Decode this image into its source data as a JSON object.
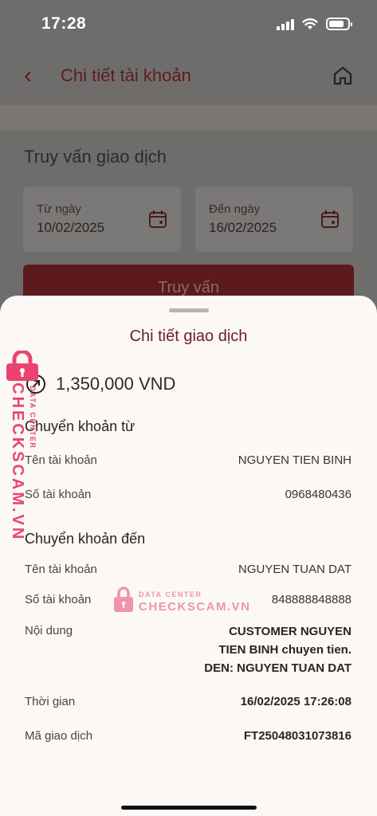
{
  "status_bar": {
    "time": "17:28"
  },
  "header": {
    "title": "Chi tiết tài khoản"
  },
  "query": {
    "title": "Truy vấn giao dịch",
    "from_label": "Từ ngày",
    "from_value": "10/02/2025",
    "to_label": "Đến ngày",
    "to_value": "16/02/2025",
    "button_label": "Truy vấn"
  },
  "sheet": {
    "title": "Chi tiết giao dịch",
    "amount": "1,350,000 VND",
    "from_section": {
      "title": "Chuyển khoản từ",
      "account_name_label": "Tên tài khoản",
      "account_name": "NGUYEN TIEN BINH",
      "account_number_label": "Số tài khoản",
      "account_number": "0968480436"
    },
    "to_section": {
      "title": "Chuyển khoản đến",
      "account_name_label": "Tên tài khoản",
      "account_name": "NGUYEN TUAN DAT",
      "account_number_label": "Số tài khoản",
      "account_number": "848888848888"
    },
    "content_label": "Nội dung",
    "content_lines": [
      "CUSTOMER NGUYEN",
      "TIEN BINH chuyen tien.",
      "DEN: NGUYEN TUAN DAT"
    ],
    "time_label": "Thời gian",
    "time_value": "16/02/2025 17:26:08",
    "txn_id_label": "Mã giao dịch",
    "txn_id_value": "FT25048031073816"
  },
  "watermark": {
    "brand": "CHECKSCAM.VN",
    "tagline": "DATA CENTER"
  },
  "colors": {
    "brand_red": "#6b1f22",
    "watermark_pink": "#e8446f",
    "sheet_bg": "#fbf8f6"
  }
}
